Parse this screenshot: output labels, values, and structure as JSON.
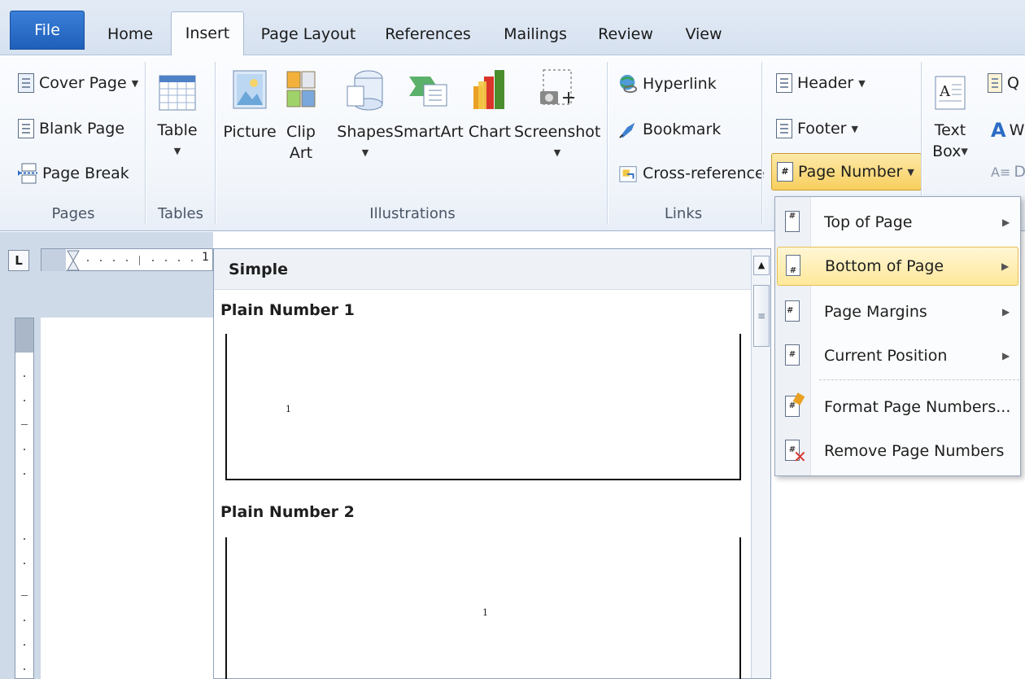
{
  "tabs": [
    {
      "label": "File"
    },
    {
      "label": "Home"
    },
    {
      "label": "Insert"
    },
    {
      "label": "Page Layout"
    },
    {
      "label": "References"
    },
    {
      "label": "Mailings"
    },
    {
      "label": "Review"
    },
    {
      "label": "View"
    }
  ],
  "ribbon": {
    "pages": {
      "cover_page": "Cover Page",
      "blank_page": "Blank Page",
      "page_break": "Page Break",
      "label": "Pages"
    },
    "tables": {
      "table": "Table",
      "label": "Tables"
    },
    "illustrations": {
      "picture": "Picture",
      "clip_art_1": "Clip",
      "clip_art_2": "Art",
      "shapes": "Shapes",
      "smartart": "SmartArt",
      "chart": "Chart",
      "screenshot": "Screenshot",
      "label": "Illustrations"
    },
    "links": {
      "hyperlink": "Hyperlink",
      "bookmark": "Bookmark",
      "cross_reference": "Cross-reference",
      "label": "Links"
    },
    "header_footer": {
      "header": "Header",
      "footer": "Footer",
      "page_number": "Page Number"
    },
    "text": {
      "text_box_1": "Text",
      "text_box_2": "Box",
      "cut_q": "Q",
      "cut_w": "W",
      "cut_d": "D"
    },
    "caret": "▼"
  },
  "ruler": {
    "tab_selector": "L",
    "tick": "1"
  },
  "gallery": {
    "header": "Simple",
    "items": [
      {
        "title": "Plain Number 1",
        "number": "1"
      },
      {
        "title": "Plain Number 2",
        "number": "1"
      }
    ],
    "scroll_up": "▲",
    "scroll_grip": "≡"
  },
  "menu": {
    "items": [
      {
        "label": "Top of Page",
        "submenu": "▶"
      },
      {
        "label": "Bottom of Page",
        "submenu": "▶"
      },
      {
        "label": "Page Margins",
        "submenu": "▶"
      },
      {
        "label": "Current Position",
        "submenu": "▶"
      },
      {
        "label": "Format Page Numbers..."
      },
      {
        "label": "Remove Page Numbers"
      }
    ]
  },
  "colors": {
    "file_tab": "#2a6cc8",
    "highlight": "#ffe89a",
    "ribbon_bg": "#f2f6fb"
  }
}
